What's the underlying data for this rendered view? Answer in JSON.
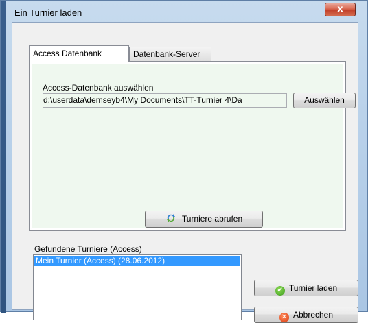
{
  "window": {
    "title": "Ein Turnier laden",
    "close_symbol": "x"
  },
  "tabs": [
    {
      "label": "Access Datenbank",
      "selected": true
    },
    {
      "label": "Datenbank-Server",
      "selected": false
    }
  ],
  "access_tab": {
    "db_label": "Access-Datenbank auswählen",
    "db_path": "d:\\userdata\\demseyb4\\My Documents\\TT-Turnier 4\\Da",
    "select_button": "Auswählen",
    "fetch_button": "Turniere abrufen",
    "fetch_icon": "refresh-arrows-icon",
    "background_color": "#eff8ef"
  },
  "found": {
    "label": "Gefundene Turniere (Access)",
    "items": [
      {
        "label": "Mein Turnier (Access) (28.06.2012)",
        "selected": true
      }
    ]
  },
  "actions": {
    "load_button": "Turnier laden",
    "load_icon": "green-check-icon",
    "cancel_button": "Abbrechen",
    "cancel_icon": "red-x-icon"
  },
  "colors": {
    "selection": "#3399ff",
    "close_button": "#c2412a"
  }
}
